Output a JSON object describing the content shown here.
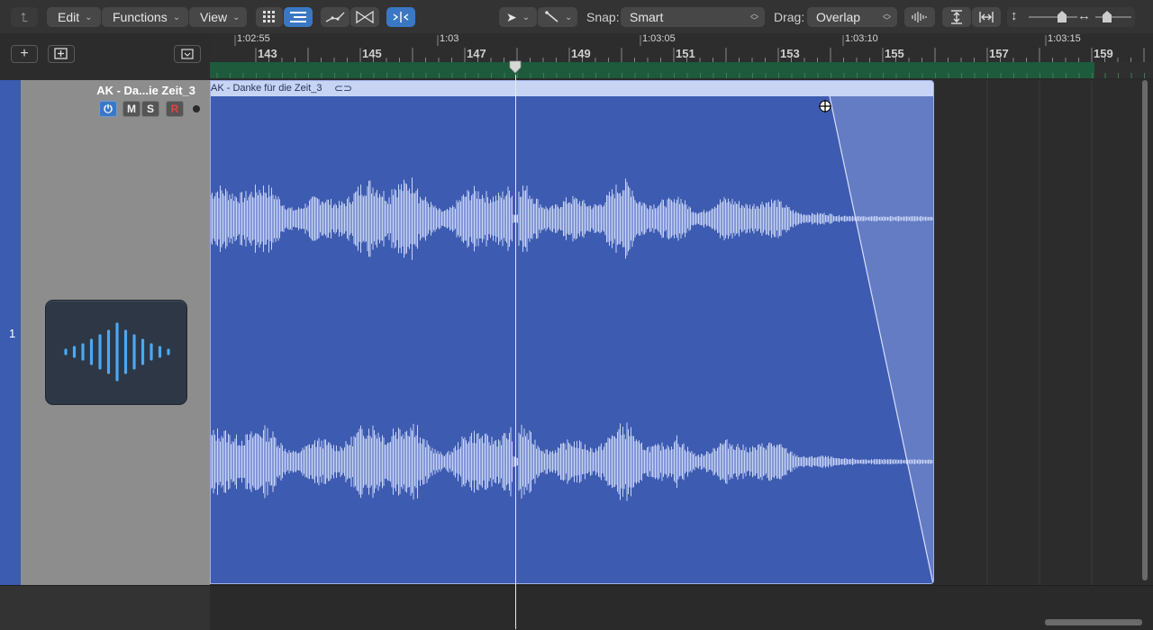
{
  "toolbar": {
    "edit_label": "Edit",
    "functions_label": "Functions",
    "view_label": "View",
    "snap_label": "Snap:",
    "snap_value": "Smart",
    "drag_label": "Drag:",
    "drag_value": "Overlap"
  },
  "ruler": {
    "time_labels": [
      "1:02:55",
      "1:03",
      "1:03:05",
      "1:03:10",
      "1:03:15"
    ],
    "bar_labels": [
      "143",
      "145",
      "147",
      "149",
      "151",
      "153",
      "155",
      "157",
      "159"
    ]
  },
  "track": {
    "number": "1",
    "name": "AK - Da...ie Zeit_3",
    "mute_label": "M",
    "solo_label": "S",
    "record_label": "R"
  },
  "region": {
    "name": "AK - Danke für die Zeit_3"
  },
  "colors": {
    "region_fill": "#3d5bb0",
    "region_header": "#c8d4f4",
    "waveform": "#c9d4f7",
    "cycle_bar": "#1e5a3c",
    "accent": "#3a78c4"
  }
}
